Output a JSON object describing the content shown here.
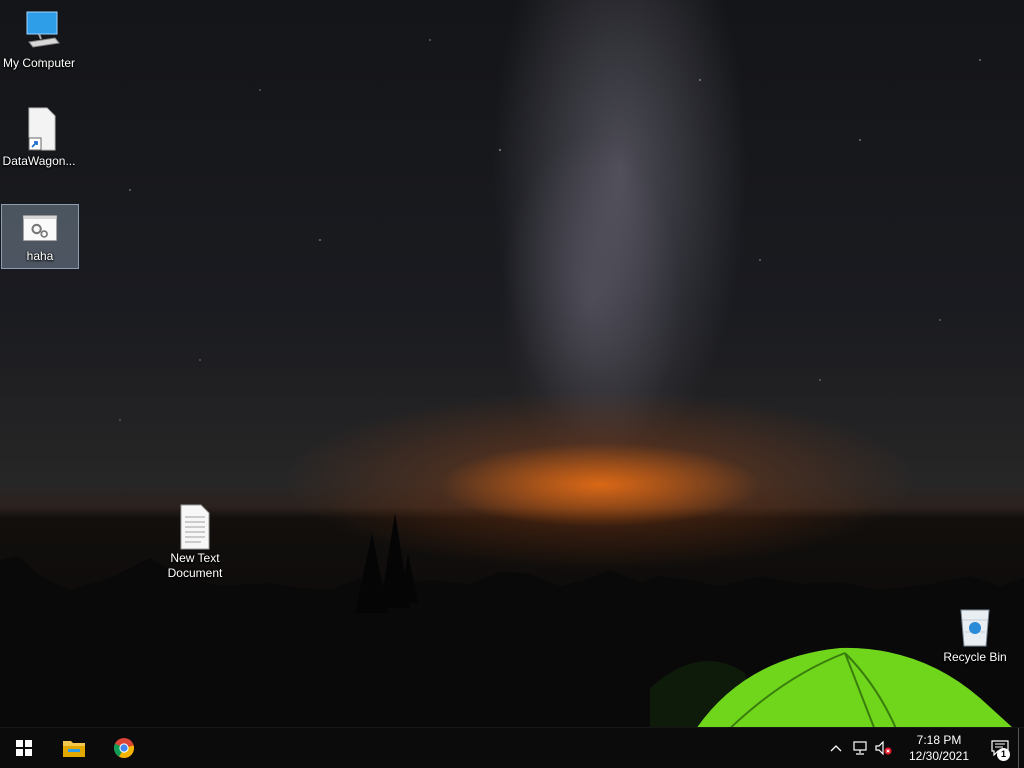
{
  "desktop": {
    "icons": [
      {
        "label": "My Computer"
      },
      {
        "label": "DataWagon..."
      },
      {
        "label": "haha"
      },
      {
        "label": "New Text Document"
      },
      {
        "label": "Recycle Bin"
      }
    ]
  },
  "taskbar": {
    "pinned": [
      {
        "name": "start-button-icon"
      },
      {
        "name": "file-explorer-icon"
      },
      {
        "name": "chrome-icon"
      }
    ],
    "tray": {
      "time": "7:18 PM",
      "date": "12/30/2021",
      "notification_count": "1"
    }
  },
  "colors": {
    "accent_blue": "#2f9ee8",
    "tent_green": "#7ddc24",
    "sunset_orange": "#ff7814",
    "taskbar_bg": "#0b0b0c"
  }
}
